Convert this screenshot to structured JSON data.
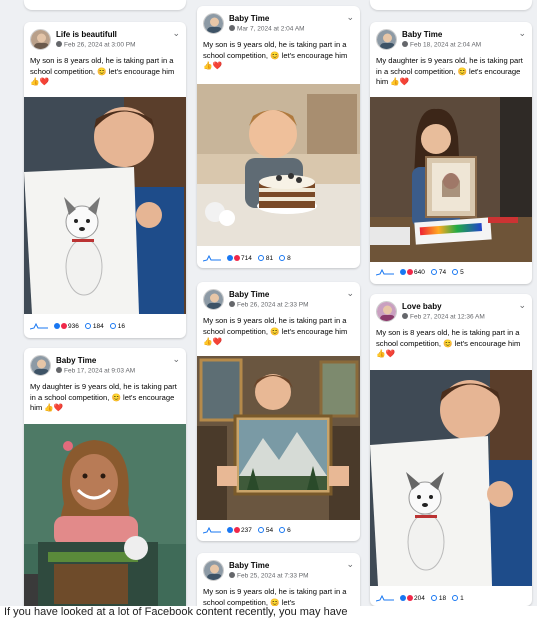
{
  "posts": [
    {
      "author": "Life is beautifull",
      "date": "Feb 26, 2024 at 3:00 PM",
      "text": "My son is 8 years old, he is taking part in a school competition, 😊 let's encourage him 👍❤️",
      "reactions": "936",
      "comments": "184",
      "shares": "16"
    },
    {
      "author": "Baby Time",
      "date": "Mar 7, 2024 at 2:04 AM",
      "text": "My son is 9 years old, he is taking part in a school competition, 😊 let's encourage him 👍❤️",
      "reactions": "714",
      "comments": "81",
      "shares": "8"
    },
    {
      "author": "Baby Time",
      "date": "Feb 18, 2024 at 2:04 AM",
      "text": "My daughter is 9 years old, he is taking part in a school competition, 😊 let's encourage him 👍❤️",
      "reactions": "640",
      "comments": "74",
      "shares": "5"
    },
    {
      "author": "Baby Time",
      "date": "Feb 17, 2024 at 9:03 AM",
      "text": "My daughter is 9 years old, he is taking part in a school competition, 😊 let's encourage him 👍❤️"
    },
    {
      "author": "Baby Time",
      "date": "Feb 26, 2024 at 2:33 PM",
      "text": "My son is 9 years old, he is taking part in a school competition, 😊 let's encourage him 👍❤️",
      "reactions": "237",
      "comments": "54",
      "shares": "6"
    },
    {
      "author": "Love baby",
      "date": "Feb 27, 2024 at 12:36 AM",
      "text": "My son is 8 years old, he is taking part in a school competition, 😊 let's encourage him 👍❤️",
      "reactions": "204",
      "comments": "18",
      "shares": "1"
    },
    {
      "author": "Baby Time",
      "date": "Feb 25, 2024 at 7:33 PM",
      "text": "My son is 9 years old, he is taking part in a school competition, 😊 let's"
    }
  ],
  "bottom_text": "If you have looked at a lot of Facebook content recently, you may have",
  "colors": {
    "accent": "#1877f2",
    "love": "#f02849",
    "bg": "#eef0f3"
  }
}
